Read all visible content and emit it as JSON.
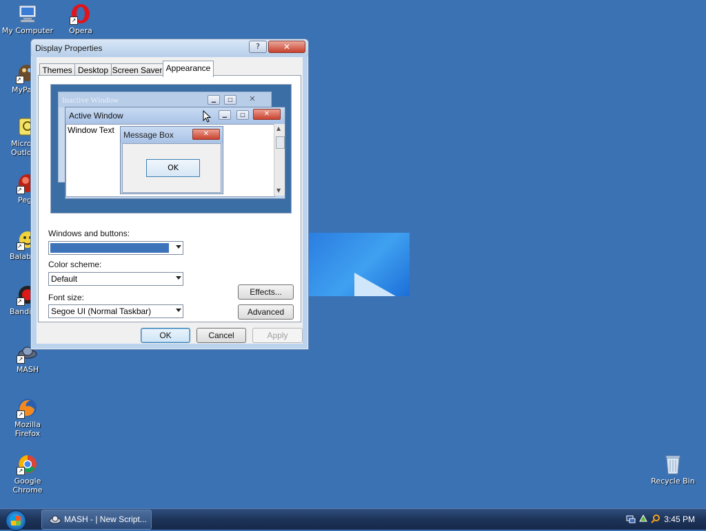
{
  "desktop": {
    "icons": [
      {
        "label": "My Computer",
        "icon": "my-computer-icon"
      },
      {
        "label": "Opera",
        "icon": "opera-icon"
      },
      {
        "label": "MyPa",
        "icon": "mypaint-icon"
      },
      {
        "label": "Micro Outlo",
        "icon": "outlook-icon"
      },
      {
        "label": "Peg",
        "icon": "pegasus-icon"
      },
      {
        "label": "Balab",
        "icon": "balabolka-icon"
      },
      {
        "label": "Bandi",
        "icon": "bandicam-icon"
      },
      {
        "label": "MASH",
        "icon": "mash-icon"
      },
      {
        "label": "Mozilla Firefox",
        "icon": "firefox-icon"
      },
      {
        "label": "Google Chrome",
        "icon": "chrome-icon"
      },
      {
        "label": "Recycle Bin",
        "icon": "recycle-bin-icon"
      }
    ]
  },
  "dialog": {
    "title": "Display Properties",
    "help_label": "?",
    "close_label": "✕",
    "tabs": [
      {
        "label": "Themes"
      },
      {
        "label": "Desktop"
      },
      {
        "label": "Screen Saver"
      },
      {
        "label": "Appearance",
        "active": true
      }
    ],
    "preview": {
      "inactive_title": "Inactive Window",
      "active_title": "Active Window",
      "window_text": "Window Text",
      "message_title": "Message Box",
      "message_ok": "OK"
    },
    "windows_buttons_label": "Windows and buttons:",
    "windows_buttons_value_color": "#3d73b9",
    "color_scheme_label": "Color scheme:",
    "color_scheme_value": "Default",
    "font_size_label": "Font size:",
    "font_size_value": "Segoe UI (Normal Taskbar)",
    "effects_label": "Effects...",
    "advanced_label": "Advanced",
    "ok_label": "OK",
    "cancel_label": "Cancel",
    "apply_label": "Apply"
  },
  "taskbar": {
    "task_label": "MASH - | New Script...",
    "clock": "3:45 PM"
  }
}
